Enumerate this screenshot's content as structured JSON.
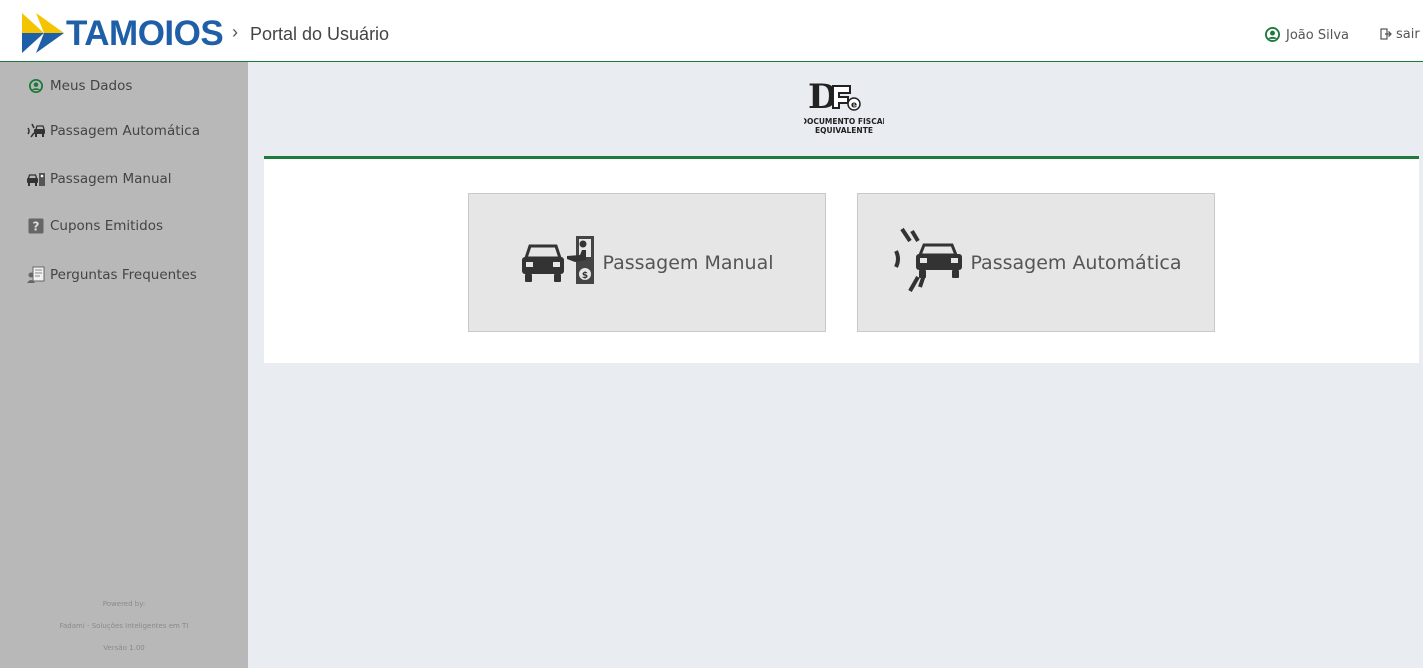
{
  "header": {
    "brand": "TAMOIOS",
    "separator": "›",
    "portal_title": "Portal do Usuário",
    "user_name": "João Silva",
    "logout_label": "sair",
    "colors": {
      "brand_blue": "#1f5fa8",
      "logo_yellow": "#f5c400",
      "logo_blue": "#1f5fa8",
      "accent_green": "#1e7a3c"
    }
  },
  "sidebar": {
    "items": [
      {
        "label": "Meus Dados",
        "icon": "user-circle-icon"
      },
      {
        "label": "Passagem Automática",
        "icon": "auto-toll-icon"
      },
      {
        "label": "Passagem Manual",
        "icon": "manual-toll-icon"
      },
      {
        "label": "Cupons Emitidos",
        "icon": "help-box-icon"
      },
      {
        "label": "Perguntas Frequentes",
        "icon": "faq-icon"
      }
    ],
    "footer": {
      "powered_by": "Powered by:",
      "company": "Fadami - Soluções Inteligentes em TI",
      "version": "Versão 1.00"
    }
  },
  "main": {
    "logo": {
      "letters": "D",
      "sup": "e",
      "line1": "DOCUMENTO FISCAL",
      "line2": "EQUIVALENTE"
    },
    "tiles": [
      {
        "label": "Passagem Manual",
        "icon": "manual-toll-icon"
      },
      {
        "label": "Passagem Automática",
        "icon": "auto-toll-icon"
      }
    ]
  }
}
